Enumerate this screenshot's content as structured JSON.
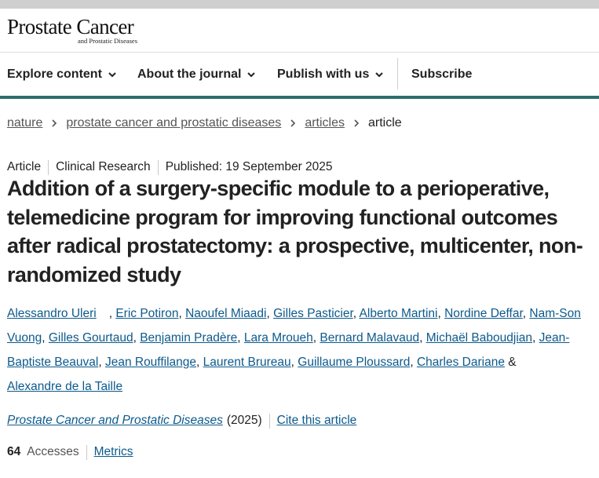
{
  "header": {
    "logo_main": "Prostate Cancer",
    "logo_sub": "and Prostatic Diseases"
  },
  "nav": {
    "explore": "Explore content",
    "about": "About the journal",
    "publish": "Publish with us",
    "subscribe": "Subscribe"
  },
  "breadcrumb": {
    "items": [
      "nature",
      "prostate cancer and prostatic diseases",
      "articles"
    ],
    "current": "article"
  },
  "meta": {
    "type": "Article",
    "category": "Clinical Research",
    "published": "Published: 19 September 2025"
  },
  "title": "Addition of a surgery-specific module to a perioperative, telemedicine program for improving functional outcomes after radical prostatectomy: a prospective, multicenter, non-randomized study",
  "authors": [
    "Alessandro Uleri",
    "Eric Potiron",
    "Naoufel Miaadi",
    "Gilles Pasticier",
    "Alberto Martini",
    "Nordine Deffar",
    "Nam-Son Vuong",
    "Gilles Gourtaud",
    "Benjamin Pradère",
    "Lara Mroueh",
    "Bernard Malavaud",
    "Michaël Baboudjian",
    "Jean-Baptiste Beauval",
    "Jean Rouffilange",
    "Laurent Brureau",
    "Guillaume Ploussard",
    "Charles Dariane",
    "Alexandre de la Taille"
  ],
  "journal": {
    "name": "Prostate Cancer and Prostatic Diseases",
    "year": "(2025)",
    "cite": "Cite this article"
  },
  "metrics": {
    "accesses_count": "64",
    "accesses_label": "Accesses",
    "metrics_link": "Metrics"
  },
  "colors": {
    "accent_green": "#2d6e6a",
    "link_blue": "#0c5a8c"
  }
}
